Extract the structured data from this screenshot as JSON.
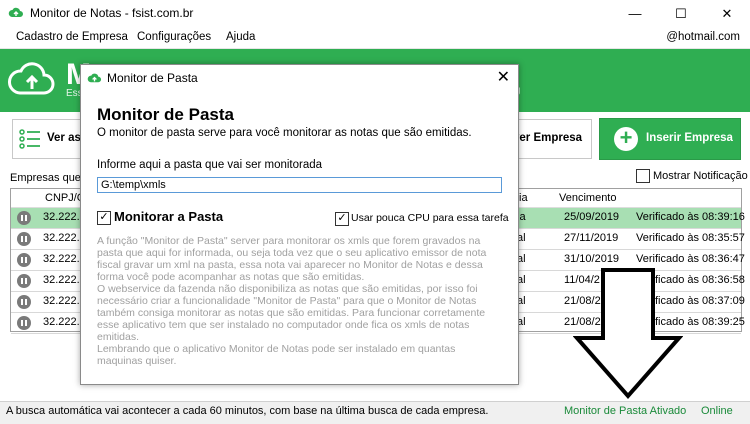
{
  "window": {
    "title": "Monitor de Notas - fsist.com.br",
    "minimize": "—",
    "maximize": "☐",
    "close": "✕"
  },
  "menu": {
    "items": [
      "Cadastro de Empresa",
      "Configurações",
      "Ajuda"
    ],
    "email": "@hotmail.com"
  },
  "banner": {
    "title": "Mo",
    "subtitle": "Ess",
    "subtitle_right": "J"
  },
  "toolbar": {
    "ver_label": "Ver as",
    "ver_empresa_label": "ver Empresa",
    "inserir_label": "Inserir Empresa"
  },
  "list": {
    "label": "Empresas que o",
    "mostrar_notificacao": "Mostrar Notificação",
    "headers": {
      "cnpj": "CNPJ/C",
      "ia": "ia",
      "vencimento": "Vencimento"
    },
    "rows": [
      {
        "cnpj": "32.222.1",
        "ia": "ia",
        "vencimento": "25/09/2019",
        "status": "Verificado às 08:39:16"
      },
      {
        "cnpj": "32.222.1",
        "ia": "al",
        "vencimento": "27/11/2019",
        "status": "Verificado às 08:35:57"
      },
      {
        "cnpj": "32.222.1",
        "ia": "al",
        "vencimento": "31/10/2019",
        "status": "Verificado às 08:36:47"
      },
      {
        "cnpj": "32.222.1",
        "ia": "al",
        "vencimento": "11/04/2",
        "status": "Verificado às 08:36:58"
      },
      {
        "cnpj": "32.222.1",
        "ia": "al",
        "vencimento": "21/08/2",
        "status": "Verificado às 08:37:09"
      },
      {
        "cnpj": "32.222.1",
        "ia": "al",
        "vencimento": "21/08/2",
        "status": "Verificado às 08:39:25"
      }
    ]
  },
  "dialog": {
    "title": "Monitor de Pasta",
    "close": "✕",
    "heading": "Monitor de Pasta",
    "description": "O monitor de pasta serve para você monitorar as notas que são emitidas.",
    "informe_label": "Informe aqui a pasta que vai ser monitorada",
    "path_value": "G:\\temp\\xmls",
    "monitorar_check": "✓",
    "monitorar_label": "Monitorar a Pasta",
    "cpu_check": "✓",
    "cpu_label": "Usar pouca CPU para essa tarefa",
    "body_lines": [
      "A função \"Monitor de Pasta\" server para monitorar os xmls que forem gravados na",
      "pasta que aqui for informada, ou seja toda vez que o seu aplicativo emissor de nota",
      "fiscal gravar um xml na pasta, essa nota vai aparecer no Monitor de Notas e dessa",
      "forma você pode acompanhar as notas que são emitidas.",
      "O webservice da fazenda não disponibiliza as notas que são emitidas, por isso foi",
      "necessário criar a funcionalidade \"Monitor de Pasta\" para que o Monitor de Notas",
      "também consiga monitorar as notas que são emitidas.  Para funcionar corretamente",
      "esse aplicativo tem que ser instalado no computador onde fica os xmls de notas",
      "emitidas.",
      "Lembrando que o aplicativo Monitor de Notas pode ser instalado em quantas",
      "maquinas quiser."
    ]
  },
  "status": {
    "text": "A busca automática vai acontecer a cada 60 minutos, com base na última busca de cada empresa.",
    "monitor": "Monitor de Pasta Ativado",
    "online": "Online"
  },
  "colors": {
    "brand_green": "#2fae52",
    "selected_row": "#a8dfb3"
  }
}
